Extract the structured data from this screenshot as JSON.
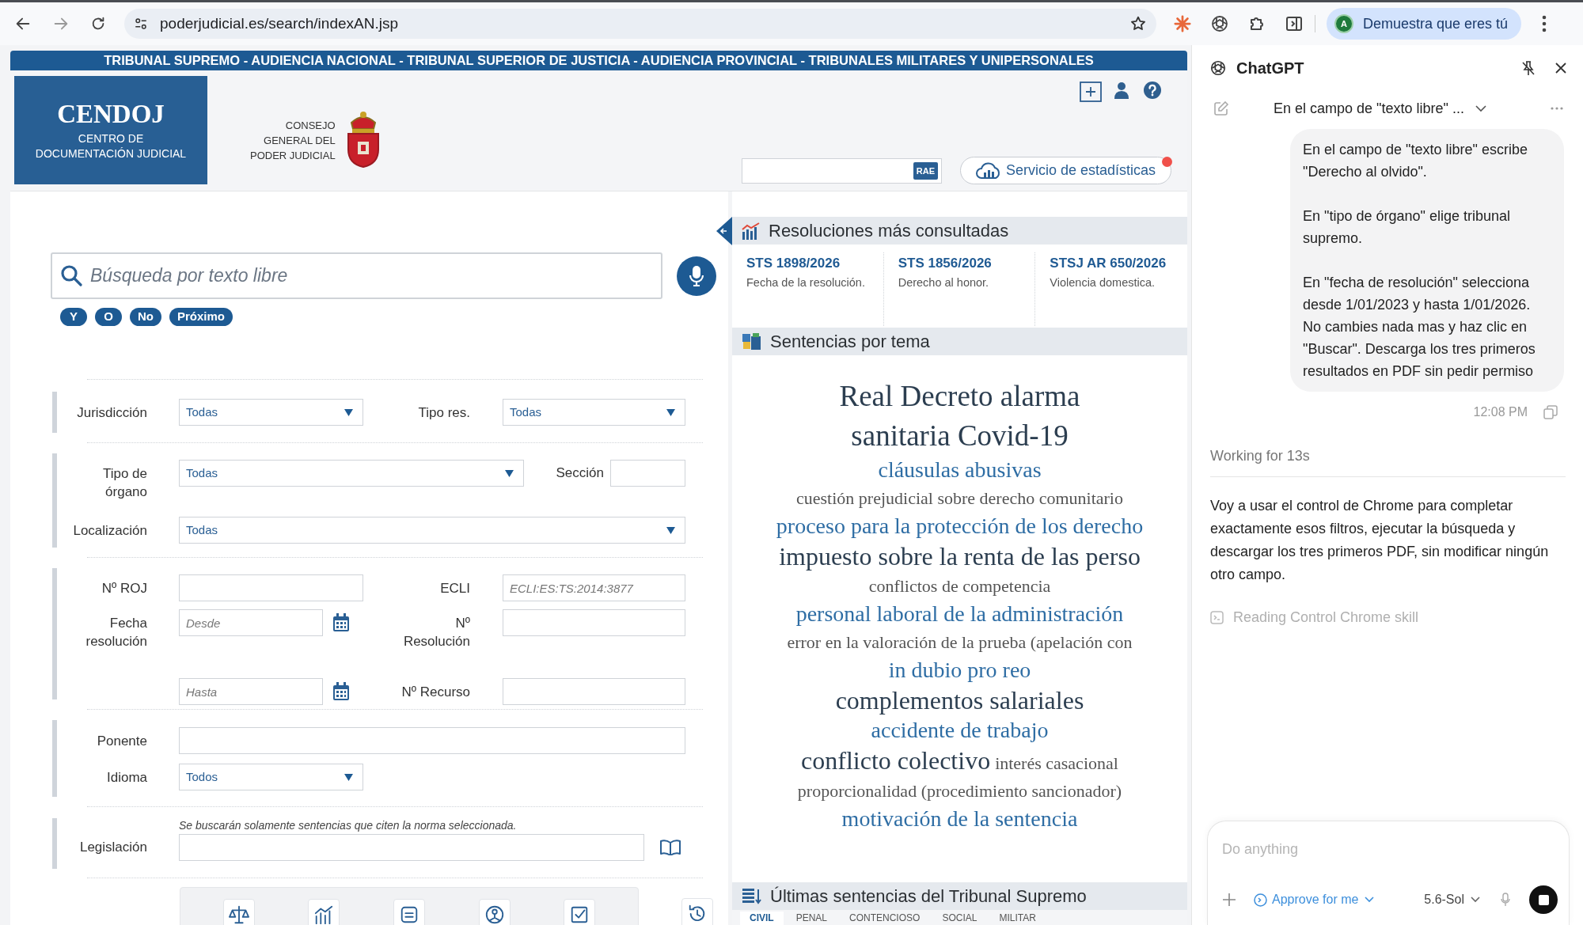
{
  "browser": {
    "url": "poderjudicial.es/search/indexAN.jsp",
    "profile_initial": "A",
    "profile_label": "Demuestra que eres tú"
  },
  "site": {
    "banner": "TRIBUNAL SUPREMO - AUDIENCIA NACIONAL - TRIBUNAL SUPERIOR DE JUSTICIA - AUDIENCIA PROVINCIAL - TRIBUNALES MILITARES Y UNIPERSONALES",
    "logo_title": "CENDOJ",
    "logo_subtitle": [
      "CENTRO DE",
      "DOCUMENTACIÓN JUDICIAL"
    ],
    "council": [
      "CONSEJO",
      "GENERAL DEL",
      "PODER JUDICIAL"
    ],
    "rae_badge": "RAE",
    "stats_button": "Servicio de estadísticas"
  },
  "search": {
    "placeholder": "Búsqueda por texto libre",
    "operators": [
      "Y",
      "O",
      "No",
      "Próximo"
    ]
  },
  "form": {
    "fields": [
      {
        "label": "Jurisdicción",
        "kind": "select",
        "value": "Todas"
      },
      {
        "label": "Tipo res.",
        "kind": "select",
        "value": "Todas"
      },
      {
        "label": "Tipo de órgano",
        "kind": "select",
        "value": "Todas"
      },
      {
        "label": "Sección",
        "kind": "text"
      },
      {
        "label": "Localización",
        "kind": "select",
        "value": "Todas"
      },
      {
        "label": "Nº ROJ",
        "kind": "text"
      },
      {
        "label": "ECLI",
        "kind": "text",
        "placeholder": "ECLI:ES:TS:2014:3877"
      },
      {
        "label": "Fecha resolución",
        "kind": "date",
        "placeholder": "Desde"
      },
      {
        "label": "Nº Resolución",
        "kind": "text"
      },
      {
        "kind": "date",
        "placeholder": "Hasta"
      },
      {
        "label": "Nº Recurso",
        "kind": "text"
      },
      {
        "label": "Ponente",
        "kind": "text"
      },
      {
        "label": "Idioma",
        "kind": "select",
        "value": "Todos"
      },
      {
        "label": "Legislación",
        "kind": "text",
        "note": "Se buscarán solamente sentencias que citen la norma seleccionada."
      }
    ]
  },
  "most_consulted": {
    "title": "Resoluciones más consultadas",
    "items": [
      {
        "title": "STS 1898/2026",
        "description": "Fecha de la resolución."
      },
      {
        "title": "STS 1856/2026",
        "description": "Derecho al honor."
      },
      {
        "title": "STSJ AR 650/2026",
        "description": "Violencia domestica."
      }
    ]
  },
  "topics": {
    "title": "Sentencias por tema",
    "lines": [
      {
        "terms": [
          {
            "text": "Real Decreto alarma sanitaria Covid-19",
            "kind": "lead"
          }
        ]
      },
      {
        "terms": [
          {
            "text": "cláusulas abusivas",
            "kind": "topic"
          }
        ]
      },
      {
        "terms": [
          {
            "text": "cuestión prejudicial sobre derecho comunitario",
            "kind": "minor"
          }
        ]
      },
      {
        "terms": [
          {
            "text": "proceso para la protección de los derecho",
            "kind": "topic"
          }
        ]
      },
      {
        "terms": [
          {
            "text": "impuesto sobre la renta de las perso",
            "kind": "major"
          }
        ]
      },
      {
        "terms": [
          {
            "text": "conflictos de competencia",
            "kind": "minor"
          }
        ]
      },
      {
        "terms": [
          {
            "text": "personal laboral de la administración",
            "kind": "topic"
          }
        ]
      },
      {
        "terms": [
          {
            "text": "error en la valoración de la prueba (apelación con",
            "kind": "minor"
          }
        ]
      },
      {
        "terms": [
          {
            "text": "in dubio pro reo",
            "kind": "topic"
          }
        ]
      },
      {
        "terms": [
          {
            "text": "complementos salariales",
            "kind": "major"
          }
        ]
      },
      {
        "terms": [
          {
            "text": "accidente de trabajo",
            "kind": "topic"
          }
        ]
      },
      {
        "terms": [
          {
            "text": "conflicto colectivo",
            "kind": "major"
          },
          {
            "text": "interés casacional",
            "kind": "minor"
          }
        ]
      },
      {
        "terms": [
          {
            "text": "proporcionalidad (procedimiento sancionador)",
            "kind": "minor"
          }
        ]
      },
      {
        "terms": [
          {
            "text": "motivación de la sentencia",
            "kind": "topic"
          }
        ]
      }
    ]
  },
  "latest": {
    "title": "Últimas sentencias del Tribunal Supremo",
    "tabs": [
      {
        "label": "CIVIL",
        "selected": true
      },
      {
        "label": "PENAL",
        "selected": false
      },
      {
        "label": "CONTENCIOSO",
        "selected": false
      },
      {
        "label": "SOCIAL",
        "selected": false
      },
      {
        "label": "MILITAR",
        "selected": false
      }
    ]
  },
  "assistant": {
    "title": "ChatGPT",
    "conversation_title": "En el campo de \"texto libre\" ...",
    "user_message": [
      "En el campo de \"texto libre\" escribe \"Derecho al olvido\".",
      "En \"tipo de órgano\" elige tribunal supremo.",
      "En \"fecha de resolución\" selecciona desde 1/01/2023 y hasta 1/01/2026. No cambies nada mas y haz clic en \"Buscar\". Descarga los tres primeros resultados en PDF sin pedir permiso"
    ],
    "time": "12:08 PM",
    "status": "Working for 13s",
    "reply": "Voy a usar el control de Chrome para completar exactamente esos filtros, ejecutar la búsqueda y descargar los tres primeros PDF, sin modificar ningún otro campo.",
    "activity": "Reading Control Chrome skill",
    "input_placeholder": "Do anything",
    "approval": "Approve for me",
    "model": "5.6-Sol"
  }
}
